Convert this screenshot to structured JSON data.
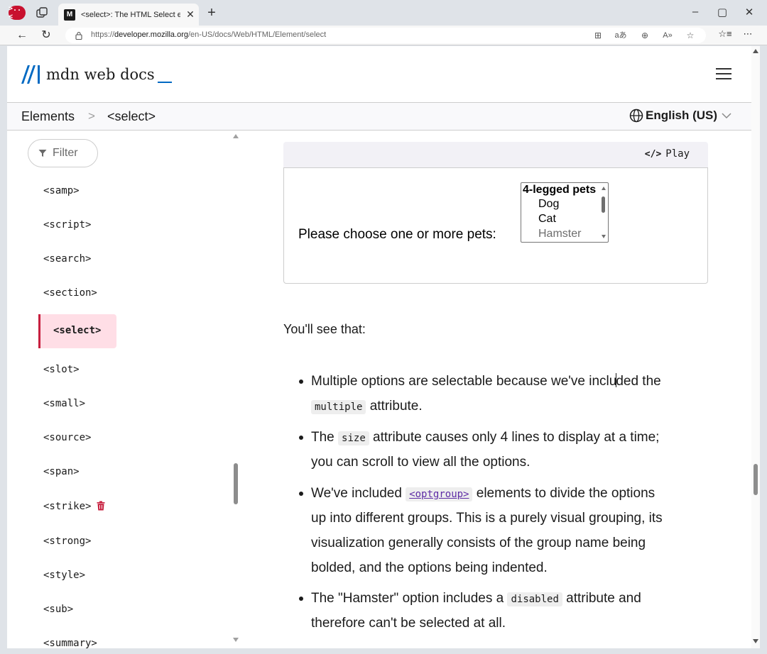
{
  "browser": {
    "profile_label": ">..<",
    "tab_title": "<select>: The HTML Select element",
    "tab_favicon": "M",
    "url_prefix": "https://",
    "url_host": "developer.mozilla.org",
    "url_path": "/en-US/docs/Web/HTML/Element/select",
    "icons": {
      "back": "back-arrow-icon",
      "reload": "reload-icon",
      "lock": "lock-icon",
      "reader": "immersive-reader-icon",
      "translate": "translate-icon",
      "zoom": "zoom-icon",
      "read_aloud": "read-aloud-icon",
      "favorite": "star-icon",
      "favorites_bar": "favorites-icon",
      "more": "more-icon"
    }
  },
  "header": {
    "logo_text": "mdn web docs"
  },
  "breadcrumb": {
    "parent": "Elements",
    "separator": ">",
    "current": "<select>"
  },
  "language": {
    "label": "English (US)"
  },
  "sidebar": {
    "filter_label": "Filter",
    "items": [
      {
        "label": "<samp>"
      },
      {
        "label": "<script>"
      },
      {
        "label": "<search>"
      },
      {
        "label": "<section>"
      },
      {
        "label": "<select>",
        "active": true
      },
      {
        "label": "<slot>"
      },
      {
        "label": "<small>"
      },
      {
        "label": "<source>"
      },
      {
        "label": "<span>"
      },
      {
        "label": "<strike>",
        "deprecated": true
      },
      {
        "label": "<strong>"
      },
      {
        "label": "<style>"
      },
      {
        "label": "<sub>"
      },
      {
        "label": "<summary>"
      }
    ]
  },
  "example": {
    "play_label": "Play",
    "prompt": "Please choose one or more pets:",
    "options": [
      {
        "label": "4-legged pets",
        "type": "optgroup"
      },
      {
        "label": "Dog",
        "type": "option"
      },
      {
        "label": "Cat",
        "type": "option"
      },
      {
        "label": "Hamster",
        "type": "option",
        "disabled": true
      }
    ]
  },
  "content": {
    "intro": "You'll see that:",
    "bullets": {
      "b1_l1_a": "Multiple options are selectable because we've inclu",
      "b1_l1_b": "ded the",
      "b1_code": "multiple",
      "b1_l2_rest": " attribute.",
      "b2_pre": "The ",
      "b2_code": "size",
      "b2_l1_rest": " attribute causes only 4 lines to display at a time;",
      "b2_l2": "you can scroll to view all the options.",
      "b3_pre": "We've included ",
      "b3_code": "<optgroup>",
      "b3_l1_rest": " elements to divide the options",
      "b3_l2": "up into different groups. This is a purely visual grouping, its",
      "b3_l3": "visualization generally consists of the group name being",
      "b3_l4": "bolded, and the options being indented.",
      "b4_pre": "The \"Hamster\" option includes a ",
      "b4_code": "disabled",
      "b4_l1_rest": " attribute and",
      "b4_l2": "therefore can't be selected at all."
    }
  },
  "colors": {
    "accent_blue": "#0069c2",
    "active_bg": "#ffdee6",
    "active_border": "#c7203f",
    "deprecated_red": "#c7203f"
  }
}
